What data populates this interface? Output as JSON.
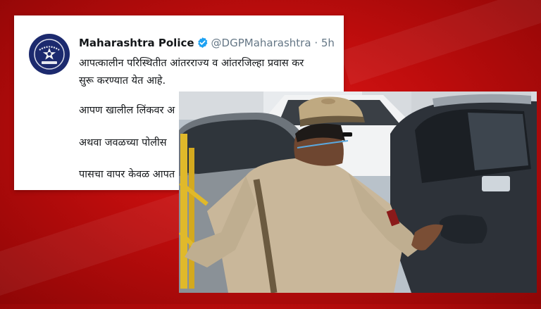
{
  "tweet": {
    "account_name": "Maharashtra Police",
    "handle": "@DGPMaharashtra",
    "separator": "·",
    "time_ago": "5h",
    "lines": [
      "आपत्कालीन परिस्थितीत आंतरराज्य व आंतरजिल्हा प्रवास कर",
      "सुरू करण्यात येत आहे.",
      "आपण खालील लिंकवर अ",
      "अथवा जवळच्या पोलीस",
      "पासचा वापर केवळ आपत"
    ],
    "verified": true
  },
  "icons": {
    "avatar": "police-badge-icon",
    "verified": "verified-badge-icon"
  },
  "colors": {
    "background": "#c00d0d",
    "avatar_bg": "#1c2a6e",
    "verified_blue": "#1da1f2",
    "card_bg": "#ffffff"
  }
}
